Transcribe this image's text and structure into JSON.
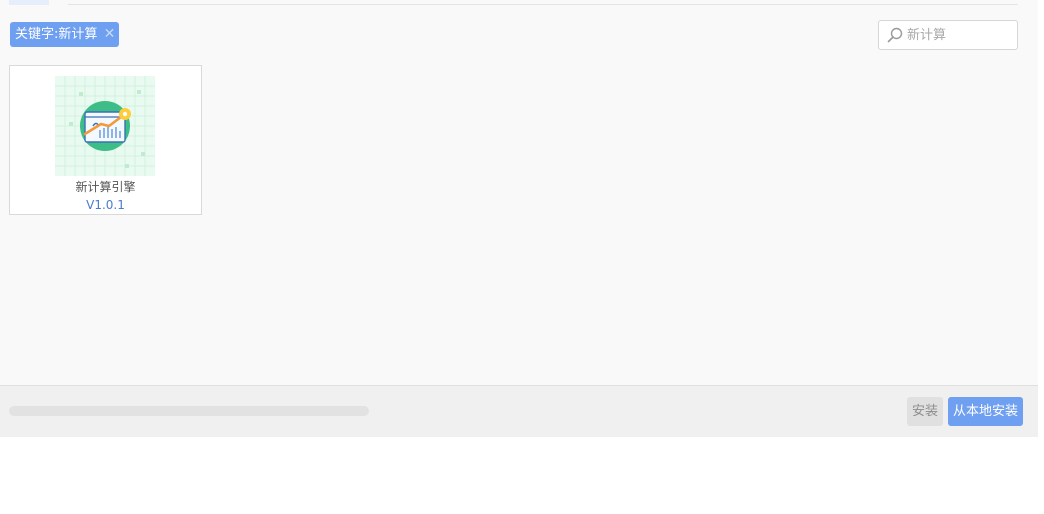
{
  "filter_tag": {
    "label": "关键字:新计算",
    "remove_glyph": "✕"
  },
  "search": {
    "value": "",
    "placeholder": "新计算",
    "icon": "search-icon"
  },
  "plugins": [
    {
      "name": "新计算引擎",
      "version": "V1.0.1",
      "icon": "compute-engine-icon"
    }
  ],
  "footer": {
    "progress": 0,
    "install_label": "安装",
    "install_local_label": "从本地安装"
  },
  "colors": {
    "accent": "#6f9ff0",
    "version_text": "#4a7ad0",
    "disabled_button": "#e0e0e0"
  }
}
